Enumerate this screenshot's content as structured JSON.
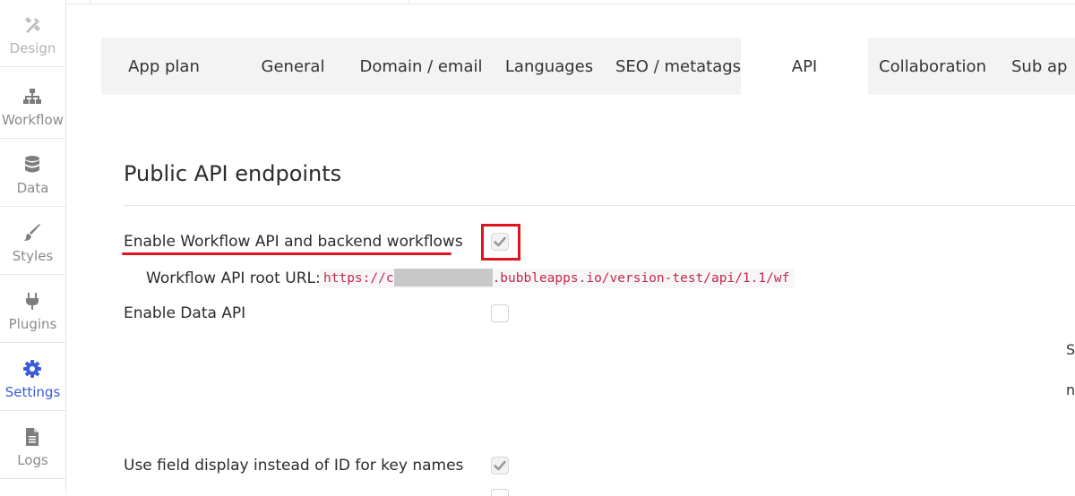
{
  "sidebar": {
    "items": [
      {
        "label": "Design",
        "icon": "design-icon"
      },
      {
        "label": "Workflow",
        "icon": "workflow-icon"
      },
      {
        "label": "Data",
        "icon": "database-icon"
      },
      {
        "label": "Styles",
        "icon": "brush-icon"
      },
      {
        "label": "Plugins",
        "icon": "plug-icon"
      },
      {
        "label": "Settings",
        "icon": "gear-icon",
        "active": true
      },
      {
        "label": "Logs",
        "icon": "document-icon"
      }
    ]
  },
  "tabs": [
    {
      "label": "App plan"
    },
    {
      "label": "General"
    },
    {
      "label": "Domain / email"
    },
    {
      "label": "Languages"
    },
    {
      "label": "SEO / metatags"
    },
    {
      "label": "API",
      "active": true
    },
    {
      "label": "Collaboration"
    },
    {
      "label": "Sub ap"
    }
  ],
  "api": {
    "section_title": "Public API endpoints",
    "enable_workflow_label": "Enable Workflow API and backend workflows",
    "enable_workflow_checked": true,
    "root_url_label": "Workflow API root URL:",
    "root_url_prefix": "https://c",
    "root_url_suffix": ".bubbleapps.io/version-test/api/1.1/wf",
    "enable_data_label": "Enable Data API",
    "enable_data_checked": false,
    "field_display_label": "Use field display instead of ID for key names",
    "field_display_checked": true,
    "edge_glyph_1": "S",
    "edge_glyph_2": "n"
  },
  "colors": {
    "accent": "#3b5bdb",
    "highlight_red": "#e0141e",
    "code_text": "#c7254e",
    "tab_bar_bg": "#f3f3f3"
  }
}
